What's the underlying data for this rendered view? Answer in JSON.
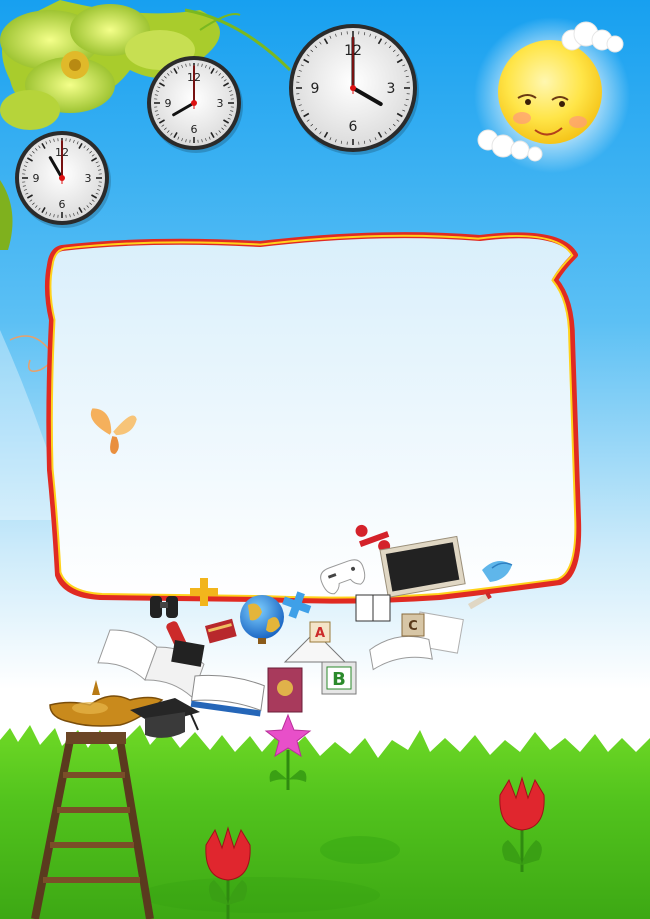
{
  "scene": {
    "colors": {
      "sky_top": "#1ea2ef",
      "sky_mid": "#9fd8f7",
      "sky_bottom": "#ffffff",
      "grass": "#4fc41c",
      "grass_dark": "#2f9d10",
      "frame_outer": "#e02a22",
      "frame_inner": "#ffd21c",
      "sun": "#ffe24a",
      "tulip": "#e0262e"
    },
    "clocks": [
      {
        "name": "clock-small-left",
        "numerals": [
          "12",
          "3",
          "6",
          "9"
        ],
        "hour": 11,
        "minute": 0
      },
      {
        "name": "clock-middle",
        "numerals": [
          "12",
          "3",
          "6",
          "9"
        ],
        "hour": 8,
        "minute": 0
      },
      {
        "name": "clock-large-right",
        "numerals": [
          "12",
          "3",
          "6",
          "9"
        ],
        "hour": 4,
        "minute": 0
      }
    ],
    "blocks": [
      "A",
      "B",
      "C"
    ],
    "icons": [
      "flower-icon",
      "sun-face-icon",
      "butterfly-icon",
      "binoculars-icon",
      "globe-icon",
      "gamepad-icon",
      "chalkboard-icon",
      "book-icon",
      "magic-lamp-icon",
      "ladder-icon",
      "graduation-cap-icon",
      "star-icon",
      "tulip-icon",
      "plus-sign-icon",
      "percent-sign-icon"
    ]
  }
}
